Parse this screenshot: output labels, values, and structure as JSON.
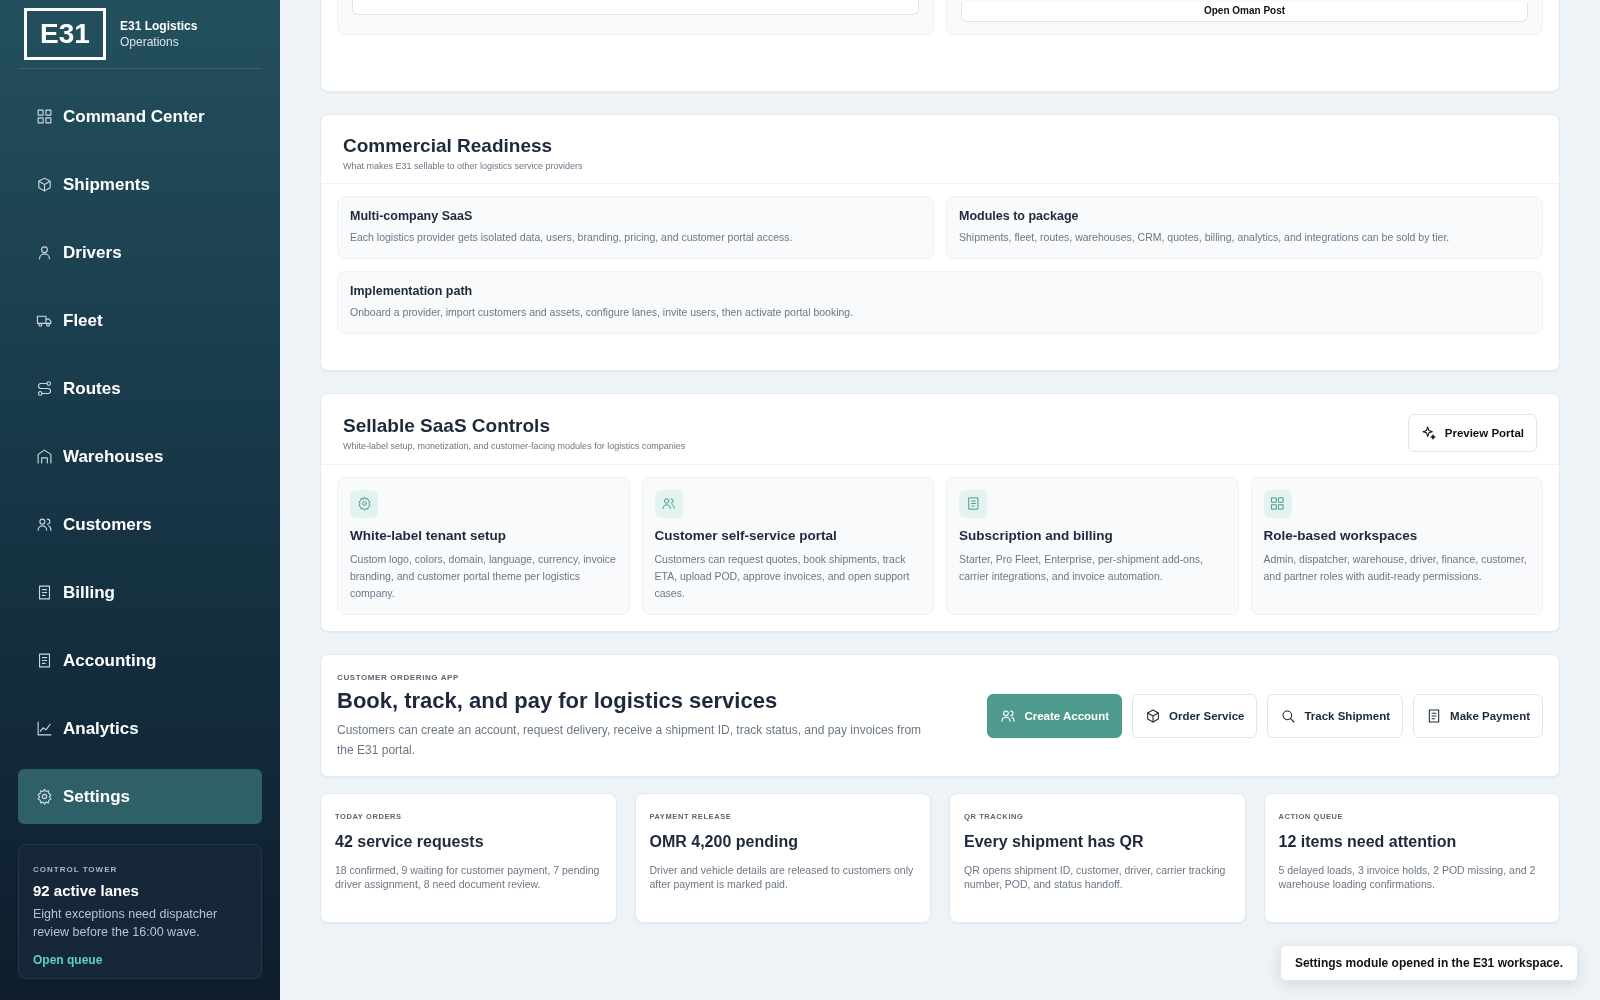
{
  "sidebar": {
    "logo": "E31",
    "brand": "E31 Logistics",
    "subtitle": "Operations",
    "items": [
      {
        "label": "Command Center",
        "selected": false
      },
      {
        "label": "Shipments",
        "selected": false
      },
      {
        "label": "Drivers",
        "selected": false
      },
      {
        "label": "Fleet",
        "selected": false
      },
      {
        "label": "Routes",
        "selected": false
      },
      {
        "label": "Warehouses",
        "selected": false
      },
      {
        "label": "Customers",
        "selected": false
      },
      {
        "label": "Billing",
        "selected": false
      },
      {
        "label": "Accounting",
        "selected": false
      },
      {
        "label": "Analytics",
        "selected": false
      },
      {
        "label": "Settings",
        "selected": true
      }
    ],
    "promo": {
      "eyebrow": "CONTROL TOWER",
      "title": "92 active lanes",
      "text": "Eight exceptions need dispatcher review before the 16:00 wave.",
      "link": "Open queue"
    }
  },
  "top_card": {
    "button": "Open Oman Post"
  },
  "commercial": {
    "title": "Commercial Readiness",
    "subtitle": "What makes E31 sellable to other logistics service providers",
    "items": [
      {
        "title": "Multi-company SaaS",
        "text": "Each logistics provider gets isolated data, users, branding, pricing, and customer portal access."
      },
      {
        "title": "Modules to package",
        "text": "Shipments, fleet, routes, warehouses, CRM, quotes, billing, analytics, and integrations can be sold by tier."
      },
      {
        "title": "Implementation path",
        "text": "Onboard a provider, import customers and assets, configure lanes, invite users, then activate portal booking."
      }
    ]
  },
  "saas": {
    "title": "Sellable SaaS Controls",
    "subtitle": "White-label setup, monetization, and customer-facing modules for logistics companies",
    "button": "Preview Portal",
    "items": [
      {
        "title": "White-label tenant setup",
        "text": "Custom logo, colors, domain, language, currency, invoice branding, and customer portal theme per logistics company."
      },
      {
        "title": "Customer self-service portal",
        "text": "Customers can request quotes, book shipments, track ETA, upload POD, approve invoices, and open support cases."
      },
      {
        "title": "Subscription and billing",
        "text": "Starter, Pro Fleet, Enterprise, per-shipment add-ons, carrier integrations, and invoice automation."
      },
      {
        "title": "Role-based workspaces",
        "text": "Admin, dispatcher, warehouse, driver, finance, customer, and partner roles with audit-ready permissions."
      }
    ]
  },
  "ordering": {
    "eyebrow": "CUSTOMER ORDERING APP",
    "title": "Book, track, and pay for logistics services",
    "text": "Customers can create an account, request delivery, receive a shipment ID, track status, and pay invoices from the E31 portal.",
    "buttons": [
      {
        "label": "Create Account",
        "kind": "primary"
      },
      {
        "label": "Order Service",
        "kind": "secondary"
      },
      {
        "label": "Track Shipment",
        "kind": "secondary"
      },
      {
        "label": "Make Payment",
        "kind": "secondary"
      }
    ]
  },
  "stats": [
    {
      "eyebrow": "TODAY ORDERS",
      "title": "42 service requests",
      "text": "18 confirmed, 9 waiting for customer payment, 7 pending driver assignment, 8 need document review."
    },
    {
      "eyebrow": "PAYMENT RELEASE",
      "title": "OMR 4,200 pending",
      "text": "Driver and vehicle details are released to customers only after payment is marked paid."
    },
    {
      "eyebrow": "QR TRACKING",
      "title": "Every shipment has QR",
      "text": "QR opens shipment ID, customer, driver, carrier tracking number, POD, and status handoff."
    },
    {
      "eyebrow": "ACTION QUEUE",
      "title": "12 items need attention",
      "text": "5 delayed loads, 3 invoice holds, 2 POD missing, and 2 warehouse loading confirmations."
    }
  ],
  "toast": "Settings module opened in the E31 workspace."
}
